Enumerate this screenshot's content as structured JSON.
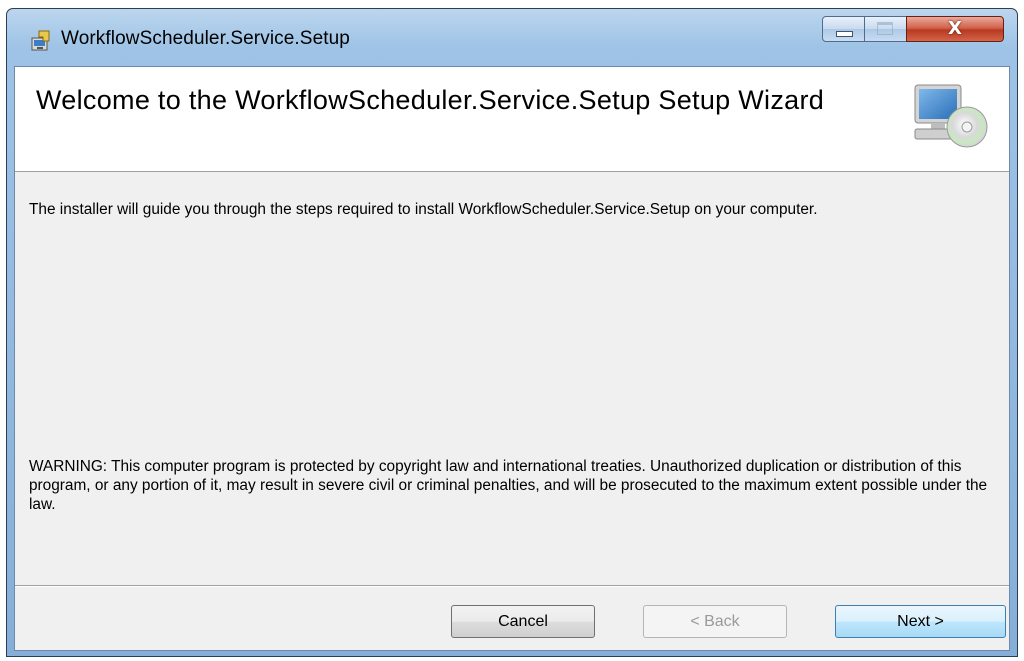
{
  "window": {
    "title": "WorkflowScheduler.Service.Setup",
    "icon": "installer-icon",
    "controls": {
      "minimize": "minimize-icon",
      "maximize": "maximize-icon",
      "close_glyph": "X"
    }
  },
  "banner": {
    "title": "Welcome to the WorkflowScheduler.Service.Setup Setup Wizard",
    "icon": "computer-cd-icon"
  },
  "content": {
    "intro": "The installer will guide you through the steps required to install WorkflowScheduler.Service.Setup on your computer.",
    "warning": "WARNING: This computer program is protected by copyright law and international treaties. Unauthorized duplication or distribution of this program, or any portion of it, may result in severe civil or criminal penalties, and will be prosecuted to the maximum extent possible under the law."
  },
  "buttons": {
    "cancel": "Cancel",
    "back": "< Back",
    "next": "Next >"
  },
  "colors": {
    "titlebar": "#9ec3e6",
    "client_bg": "#f0f0f0",
    "close": "#c7472e",
    "next_border": "#3c7fb1"
  }
}
